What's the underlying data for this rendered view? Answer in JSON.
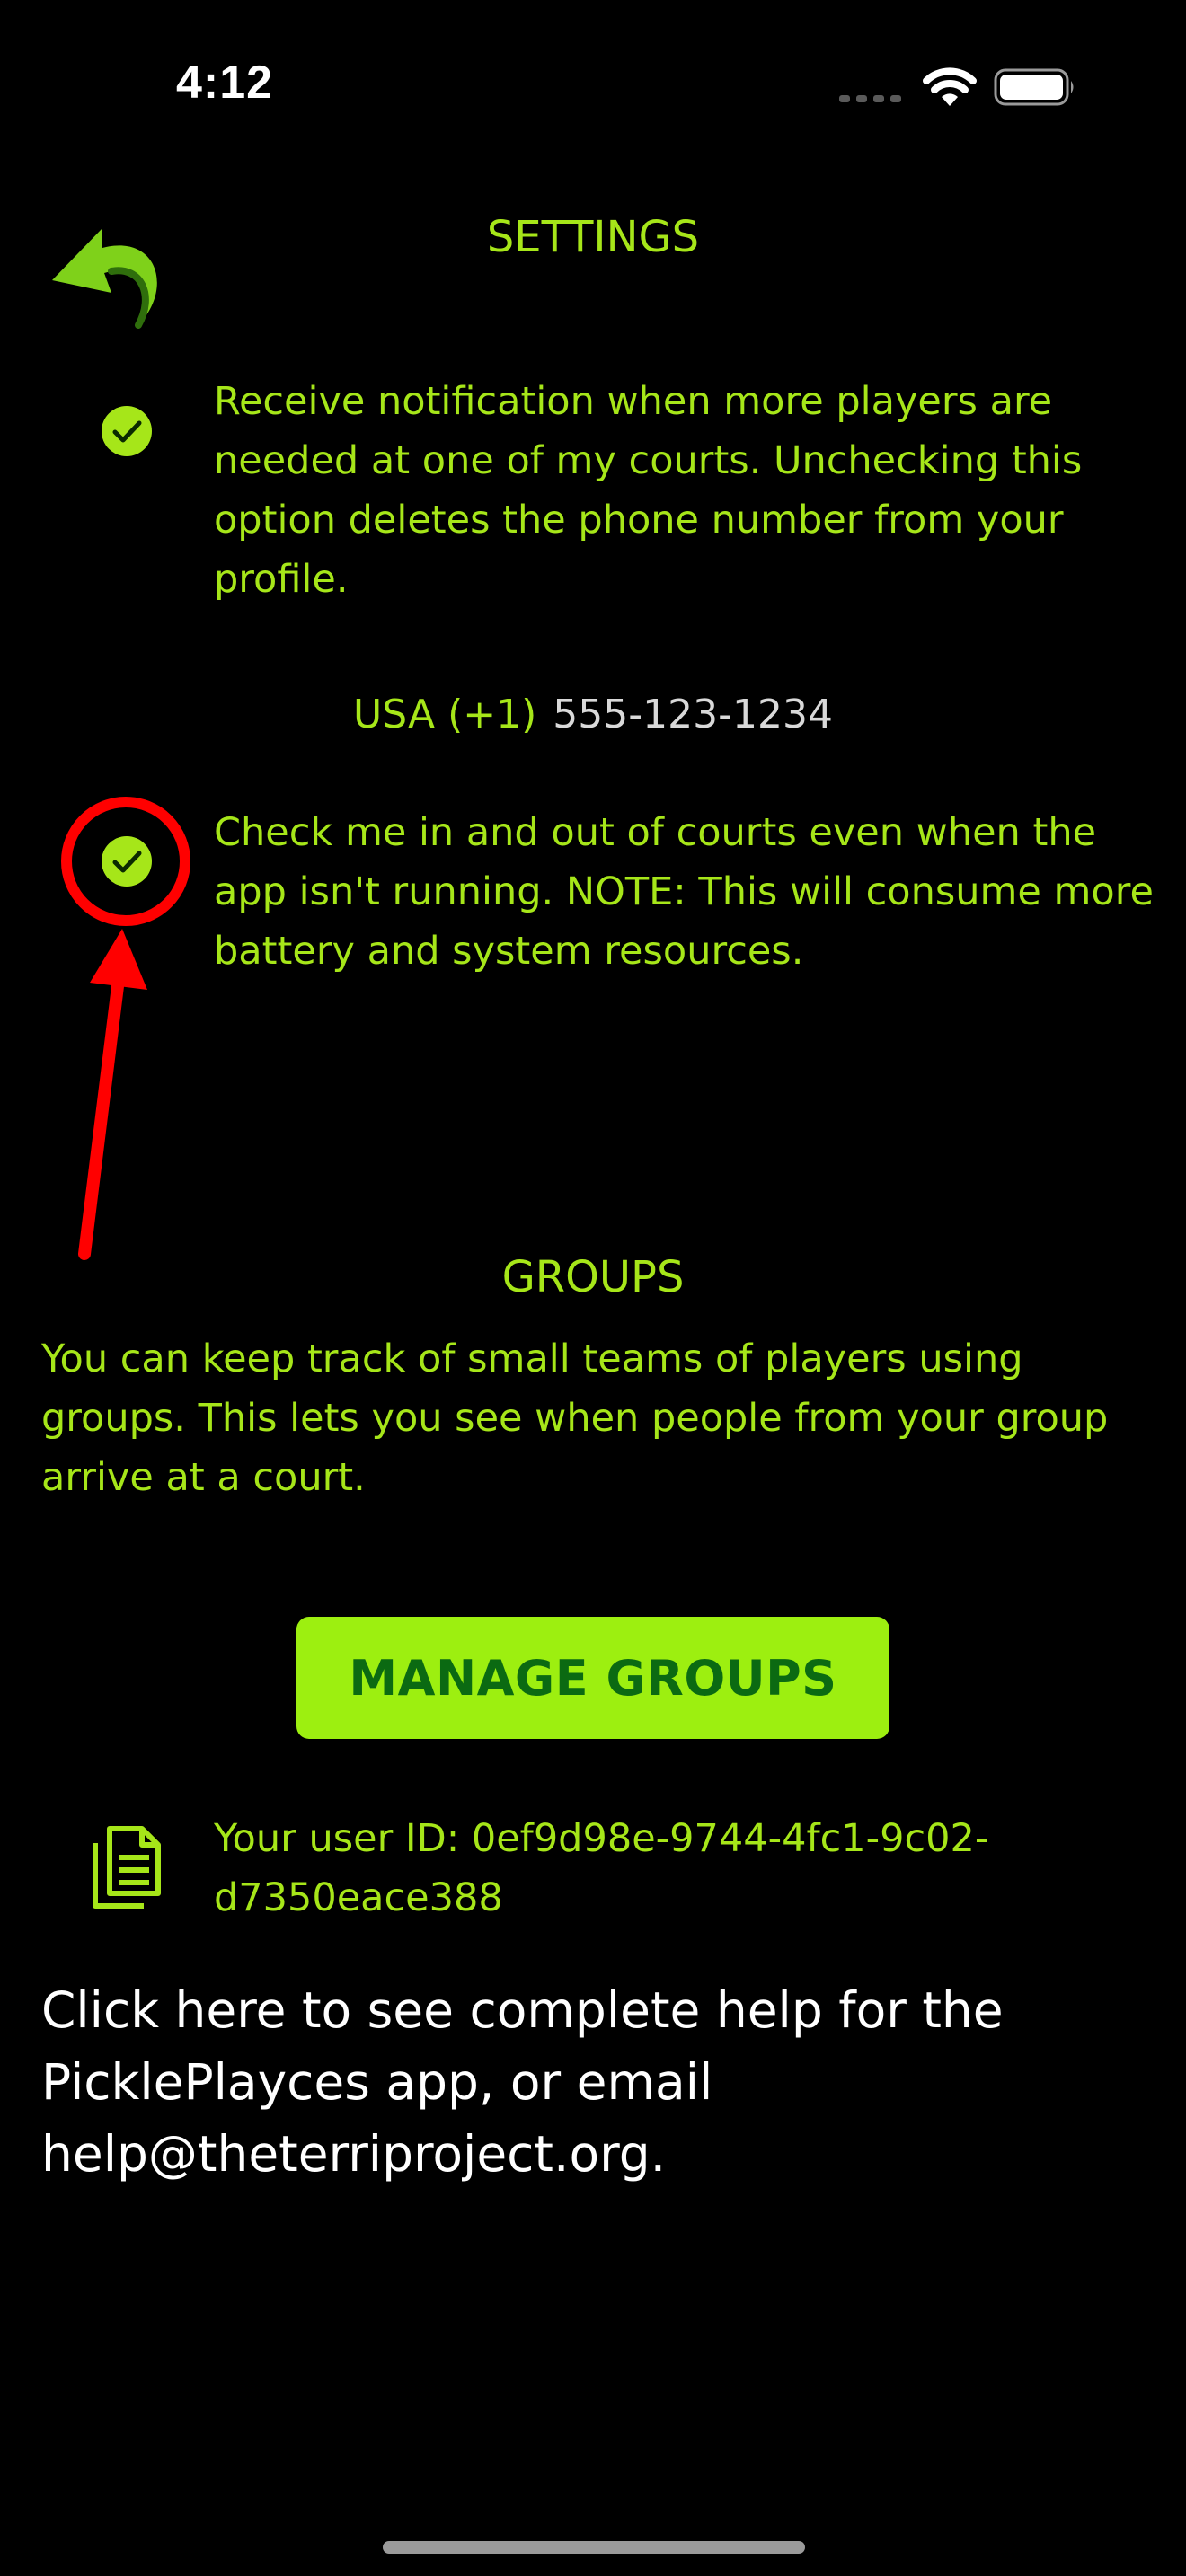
{
  "status_bar": {
    "time": "4:12"
  },
  "settings": {
    "title": "SETTINGS",
    "notify_option": {
      "checked": true,
      "label": "Receive notification when more players are needed at one of my courts. Unchecking this option deletes the phone number from your profile."
    },
    "phone": {
      "country": "USA (+1)",
      "number": "555-123-1234"
    },
    "background_option": {
      "checked": true,
      "label": "Check me in and out of courts even when the app isn't running. NOTE: This will consume more battery and system resources."
    }
  },
  "groups": {
    "title": "GROUPS",
    "description": "You can keep track of small teams of players using groups. This lets you see when people from your group arrive at a court.",
    "manage_button": "MANAGE GROUPS"
  },
  "user_id": {
    "line1": "Your user ID: 0ef9d98e-9744-4fc1-9c02-",
    "line2": "d7350eace388"
  },
  "help": {
    "text": "Click here to see complete help for the PicklePlayces app, or email help@theterriproject.org."
  },
  "colors": {
    "accent": "#a6e619",
    "button_bg": "#9def10",
    "button_text": "#0b6a12",
    "annotation": "#ff0000",
    "background": "#000000"
  }
}
